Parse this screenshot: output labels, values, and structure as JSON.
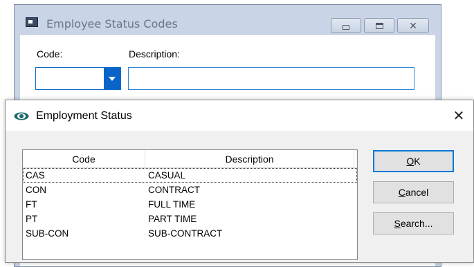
{
  "background_window": {
    "title": "Employee Status Codes",
    "code_label": "Code:",
    "description_label": "Description:",
    "code_value": "",
    "description_value": "",
    "controls": {
      "minimize": "minimize-icon",
      "maximize": "maximize-icon",
      "close": "close-icon"
    }
  },
  "dialog": {
    "title": "Employment Status",
    "icon": "eye-icon",
    "close_glyph": "✕",
    "columns": [
      "Code",
      "Description"
    ],
    "rows": [
      {
        "code": "CAS",
        "description": "CASUAL"
      },
      {
        "code": "CON",
        "description": "CONTRACT"
      },
      {
        "code": "FT",
        "description": "FULL TIME"
      },
      {
        "code": "PT",
        "description": "PART TIME"
      },
      {
        "code": "SUB-CON",
        "description": "SUB-CONTRACT"
      }
    ],
    "buttons": {
      "ok": {
        "mnemonic": "O",
        "rest": "K"
      },
      "cancel": {
        "mnemonic": "C",
        "rest": "ancel"
      },
      "search": {
        "mnemonic": "S",
        "rest": "earch..."
      }
    }
  },
  "colors": {
    "accent_blue": "#0a64c8",
    "window_frame": "#c9d5e6",
    "focus_border": "#0078d7"
  }
}
